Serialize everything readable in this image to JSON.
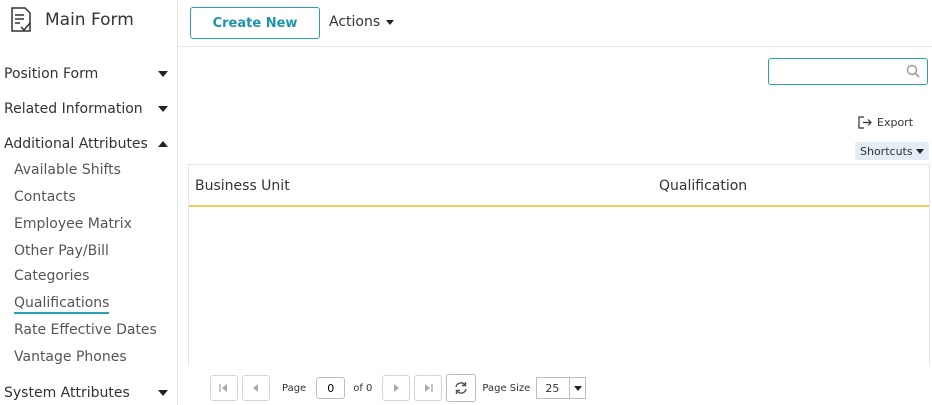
{
  "sidebar": {
    "title": "Main Form",
    "sections": [
      {
        "label": "Position Form",
        "expanded": false
      },
      {
        "label": "Related Information",
        "expanded": false
      },
      {
        "label": "Additional Attributes",
        "expanded": true
      },
      {
        "label": "System Attributes",
        "expanded": false
      }
    ],
    "sub_items": [
      {
        "label": "Available Shifts"
      },
      {
        "label": "Contacts"
      },
      {
        "label": "Employee Matrix"
      },
      {
        "label": "Other Pay/Bill"
      },
      {
        "label": "Categories"
      },
      {
        "label": "Qualifications",
        "active": true
      },
      {
        "label": "Rate Effective Dates"
      },
      {
        "label": "Vantage Phones"
      }
    ]
  },
  "toolbar": {
    "create_label": "Create New",
    "actions_label": "Actions"
  },
  "search": {
    "value": "",
    "placeholder": ""
  },
  "export_label": "Export",
  "shortcuts_label": "Shortcuts",
  "grid": {
    "columns": [
      "Business Unit",
      "Qualification"
    ],
    "rows": []
  },
  "pager": {
    "page_label": "Page",
    "page_value": "0",
    "of_label": "of 0",
    "page_size_label": "Page Size",
    "page_size": "25"
  },
  "colors": {
    "accent": "#2aa0b4",
    "header_underline": "#f2cc5c",
    "shortcuts_bg": "#e4ecf5"
  }
}
